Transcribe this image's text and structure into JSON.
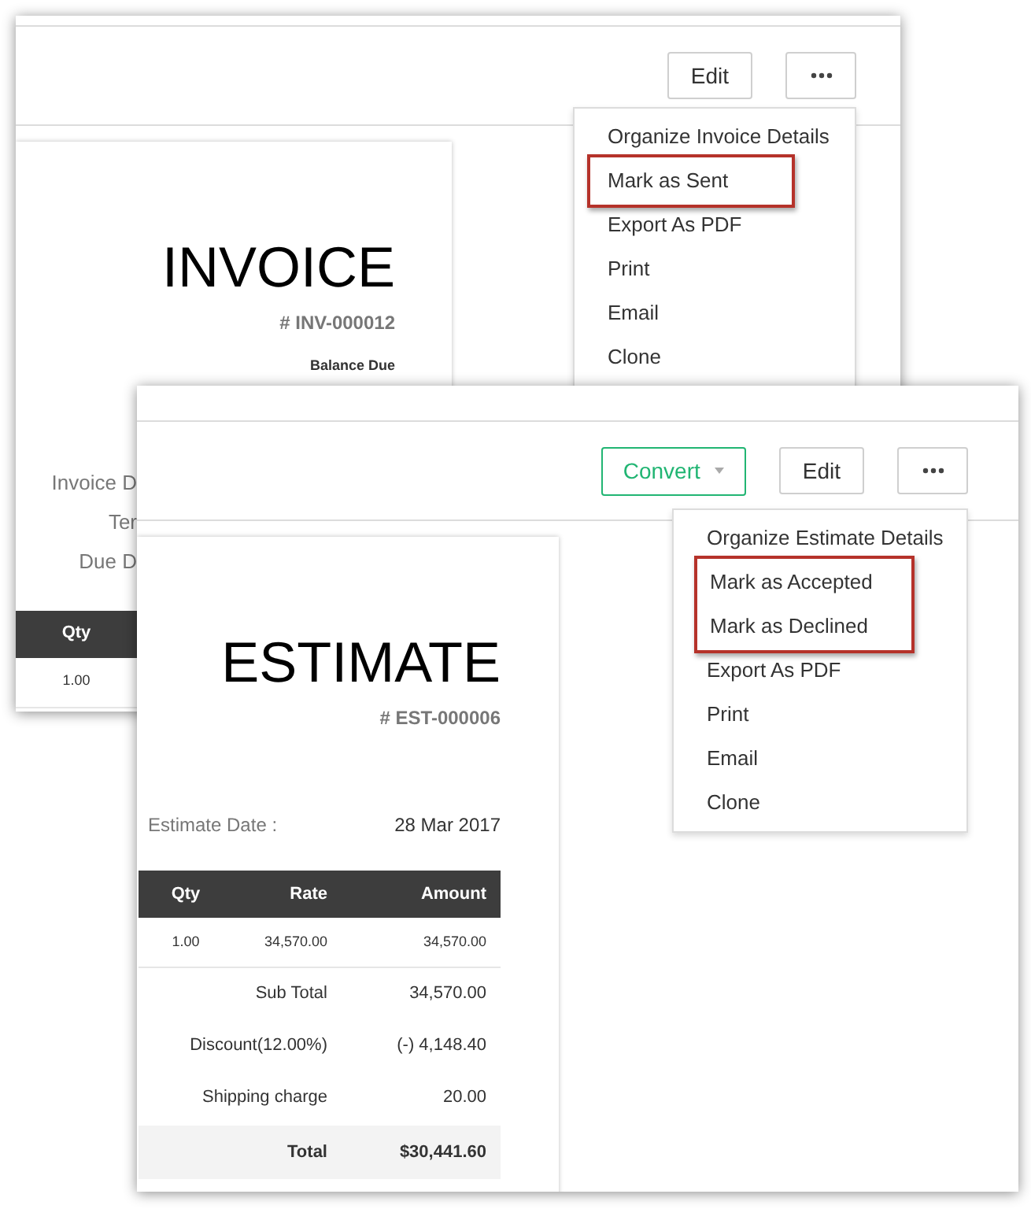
{
  "windows": [
    {
      "toolbar": [
        {
          "kind": "plain",
          "label": "Edit"
        },
        {
          "kind": "more"
        }
      ],
      "menu": [
        {
          "label": "Organize Invoice Details",
          "highlighted": false
        },
        {
          "label": "Mark as Sent",
          "highlighted": true
        },
        {
          "label": "Export As PDF",
          "highlighted": false
        },
        {
          "label": "Print",
          "highlighted": false
        },
        {
          "label": "Email",
          "highlighted": false
        },
        {
          "label": "Clone",
          "highlighted": false
        }
      ],
      "document": {
        "title": "INVOICE",
        "number": "# INV-000012",
        "balance_label": "Balance Due",
        "fields": [
          {
            "label": "Invoice D"
          },
          {
            "label": "Ter"
          },
          {
            "label": "Due D"
          }
        ],
        "table": {
          "columns": [
            "Qty"
          ],
          "rows": [
            [
              "1.00"
            ]
          ]
        }
      }
    },
    {
      "toolbar": [
        {
          "kind": "dropdown",
          "label": "Convert"
        },
        {
          "kind": "plain",
          "label": "Edit"
        },
        {
          "kind": "more"
        }
      ],
      "menu": [
        {
          "label": "Organize Estimate Details",
          "highlighted": false
        },
        {
          "label": "Mark as Accepted",
          "highlighted": true
        },
        {
          "label": "Mark as Declined",
          "highlighted": true
        },
        {
          "label": "Export As PDF",
          "highlighted": false
        },
        {
          "label": "Print",
          "highlighted": false
        },
        {
          "label": "Email",
          "highlighted": false
        },
        {
          "label": "Clone",
          "highlighted": false
        }
      ],
      "document": {
        "title": "ESTIMATE",
        "number": "# EST-000006",
        "fields": [
          {
            "label": "Estimate Date :",
            "value": "28 Mar 2017"
          }
        ],
        "table": {
          "columns": [
            "Qty",
            "Rate",
            "Amount"
          ],
          "rows": [
            [
              "1.00",
              "34,570.00",
              "34,570.00"
            ]
          ]
        },
        "totals": [
          {
            "label": "Sub Total",
            "value": "34,570.00",
            "kind": "line"
          },
          {
            "label": "Discount(12.00%)",
            "value": "(-) 4,148.40",
            "kind": "line"
          },
          {
            "label": "Shipping charge",
            "value": "20.00",
            "kind": "line"
          },
          {
            "label": "Total",
            "value": "$30,441.60",
            "kind": "total"
          }
        ]
      }
    }
  ]
}
